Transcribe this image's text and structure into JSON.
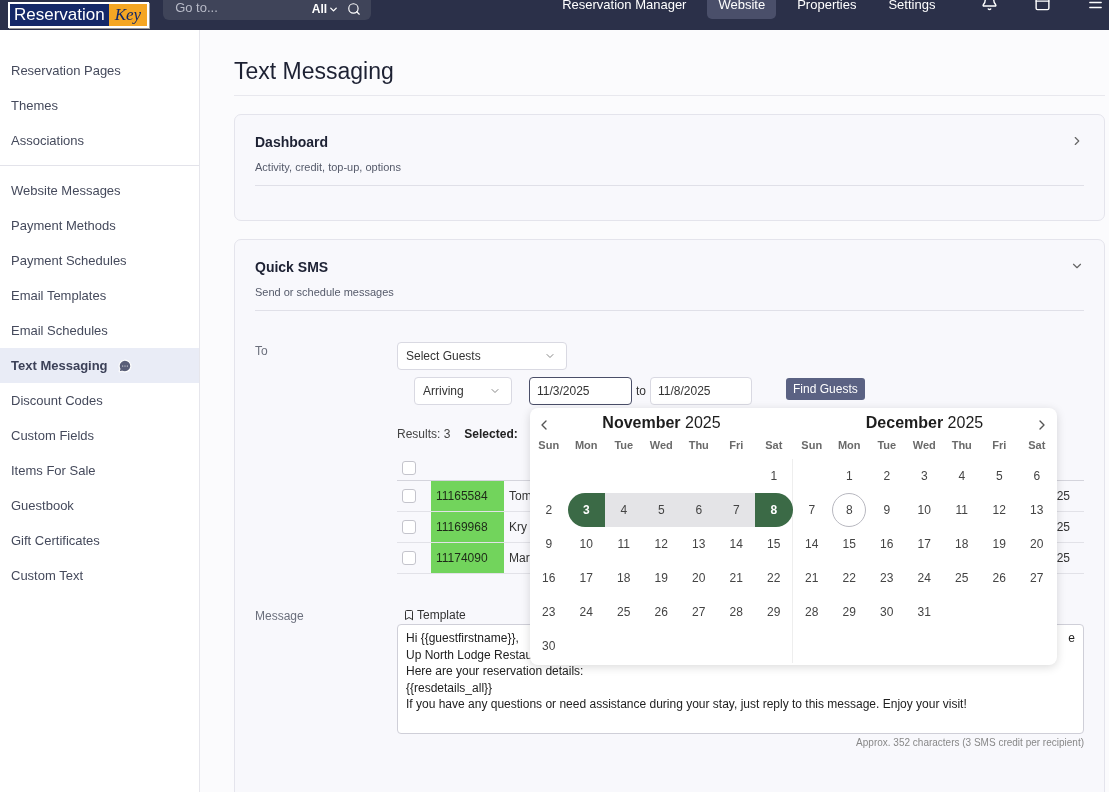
{
  "header": {
    "logo": {
      "word": "Reservation",
      "accent": "Key"
    },
    "search": {
      "placeholder": "Go to...",
      "scope": "All"
    },
    "nav": [
      {
        "label": "Reservation Manager",
        "selected": false
      },
      {
        "label": "Website",
        "selected": true
      },
      {
        "label": "Properties",
        "selected": false
      },
      {
        "label": "Settings",
        "selected": false
      }
    ]
  },
  "sidebar": {
    "groups": [
      [
        {
          "label": "Reservation Pages",
          "selected": false,
          "chat_icon": false
        },
        {
          "label": "Themes",
          "selected": false,
          "chat_icon": false
        },
        {
          "label": "Associations",
          "selected": false,
          "chat_icon": false
        }
      ],
      [
        {
          "label": "Website Messages",
          "selected": false,
          "chat_icon": false
        },
        {
          "label": "Payment Methods",
          "selected": false,
          "chat_icon": false
        },
        {
          "label": "Payment Schedules",
          "selected": false,
          "chat_icon": false
        },
        {
          "label": "Email Templates",
          "selected": false,
          "chat_icon": false
        },
        {
          "label": "Email Schedules",
          "selected": false,
          "chat_icon": false
        },
        {
          "label": "Text Messaging",
          "selected": true,
          "chat_icon": true
        },
        {
          "label": "Discount Codes",
          "selected": false,
          "chat_icon": false
        },
        {
          "label": "Custom Fields",
          "selected": false,
          "chat_icon": false
        },
        {
          "label": "Items For Sale",
          "selected": false,
          "chat_icon": false
        },
        {
          "label": "Guestbook",
          "selected": false,
          "chat_icon": false
        },
        {
          "label": "Gift Certificates",
          "selected": false,
          "chat_icon": false
        },
        {
          "label": "Custom Text",
          "selected": false,
          "chat_icon": false
        }
      ]
    ]
  },
  "page_title": "Text Messaging",
  "sections": [
    {
      "title": "Dashboard",
      "subtitle": "Activity, credit, top-up, options",
      "expanded": false
    },
    {
      "title": "Quick SMS",
      "subtitle": "Send or schedule messages",
      "expanded": true
    }
  ],
  "quick_sms": {
    "to_label": "To",
    "guest_select": "Select Guests",
    "date_filter": "Arriving",
    "date_from": "11/3/2025",
    "between": "to",
    "date_to": "11/8/2025",
    "find_button": "Find Guests",
    "results": "Results: 3",
    "selected_label": "Selected:",
    "table": {
      "header_checked": false,
      "rows": [
        {
          "checked": false,
          "id": "11165584",
          "color": "#72d45c",
          "name": "Tom",
          "column_3": "25"
        },
        {
          "checked": false,
          "id": "11169968",
          "color": "#72d45c",
          "name": "Kry",
          "column_3": "25"
        },
        {
          "checked": false,
          "id": "11174090",
          "color": "#72d45c",
          "name": "Mar",
          "column_3": "25"
        }
      ]
    },
    "message_label": "Message",
    "template_button": "Template",
    "message_lines": [
      "Hi {{guestfirstname}},",
      "Up North Lodge Restau",
      "Here are your reservation details:",
      "{{resdetails_all}}",
      "If you have any questions or need assistance during your stay, just reply to this message. Enjoy your visit!"
    ],
    "line1_tail": "e",
    "char_count": "Approx. 352 characters (3 SMS credit per recipient)"
  },
  "calendar": {
    "months": [
      {
        "month": "November",
        "year": "2025",
        "weekdays": [
          "Sun",
          "Mon",
          "Tue",
          "Wed",
          "Thu",
          "Fri",
          "Sat"
        ],
        "weeks": [
          {
            "kind": "end",
            "days": [
              {
                "d": "1",
                "selected": false,
                "in_range": false,
                "today": false
              }
            ]
          },
          {
            "kind": "full",
            "days": [
              {
                "d": "2",
                "selected": false,
                "in_range": false,
                "today": false
              },
              {
                "d": "3",
                "selected": true,
                "in_range": false,
                "today": false
              },
              {
                "d": "4",
                "selected": false,
                "in_range": true,
                "today": false
              },
              {
                "d": "5",
                "selected": false,
                "in_range": true,
                "today": false
              },
              {
                "d": "6",
                "selected": false,
                "in_range": true,
                "today": false
              },
              {
                "d": "7",
                "selected": false,
                "in_range": true,
                "today": false
              },
              {
                "d": "8",
                "selected": true,
                "in_range": false,
                "today": false
              }
            ]
          },
          {
            "kind": "full",
            "days": [
              {
                "d": "9",
                "selected": false,
                "in_range": false,
                "today": false
              },
              {
                "d": "10",
                "selected": false,
                "in_range": false,
                "today": false
              },
              {
                "d": "11",
                "selected": false,
                "in_range": false,
                "today": false
              },
              {
                "d": "12",
                "selected": false,
                "in_range": false,
                "today": false
              },
              {
                "d": "13",
                "selected": false,
                "in_range": false,
                "today": false
              },
              {
                "d": "14",
                "selected": false,
                "in_range": false,
                "today": false
              },
              {
                "d": "15",
                "selected": false,
                "in_range": false,
                "today": false
              }
            ]
          },
          {
            "kind": "full",
            "days": [
              {
                "d": "16",
                "selected": false,
                "in_range": false,
                "today": false
              },
              {
                "d": "17",
                "selected": false,
                "in_range": false,
                "today": false
              },
              {
                "d": "18",
                "selected": false,
                "in_range": false,
                "today": false
              },
              {
                "d": "19",
                "selected": false,
                "in_range": false,
                "today": false
              },
              {
                "d": "20",
                "selected": false,
                "in_range": false,
                "today": false
              },
              {
                "d": "21",
                "selected": false,
                "in_range": false,
                "today": false
              },
              {
                "d": "22",
                "selected": false,
                "in_range": false,
                "today": false
              }
            ]
          },
          {
            "kind": "full",
            "days": [
              {
                "d": "23",
                "selected": false,
                "in_range": false,
                "today": false
              },
              {
                "d": "24",
                "selected": false,
                "in_range": false,
                "today": false
              },
              {
                "d": "25",
                "selected": false,
                "in_range": false,
                "today": false
              },
              {
                "d": "26",
                "selected": false,
                "in_range": false,
                "today": false
              },
              {
                "d": "27",
                "selected": false,
                "in_range": false,
                "today": false
              },
              {
                "d": "28",
                "selected": false,
                "in_range": false,
                "today": false
              },
              {
                "d": "29",
                "selected": false,
                "in_range": false,
                "today": false
              }
            ]
          },
          {
            "kind": "start",
            "days": [
              {
                "d": "30",
                "selected": false,
                "in_range": false,
                "today": false
              }
            ]
          }
        ]
      },
      {
        "month": "December",
        "year": "2025",
        "weekdays": [
          "Sun",
          "Mon",
          "Tue",
          "Wed",
          "Thu",
          "Fri",
          "Sat"
        ],
        "weeks": [
          {
            "kind": "end",
            "days": [
              {
                "d": "1",
                "selected": false,
                "in_range": false,
                "today": false
              },
              {
                "d": "2",
                "selected": false,
                "in_range": false,
                "today": false
              },
              {
                "d": "3",
                "selected": false,
                "in_range": false,
                "today": false
              },
              {
                "d": "4",
                "selected": false,
                "in_range": false,
                "today": false
              },
              {
                "d": "5",
                "selected": false,
                "in_range": false,
                "today": false
              },
              {
                "d": "6",
                "selected": false,
                "in_range": false,
                "today": false
              }
            ]
          },
          {
            "kind": "full",
            "days": [
              {
                "d": "7",
                "selected": false,
                "in_range": false,
                "today": false
              },
              {
                "d": "8",
                "selected": false,
                "in_range": false,
                "today": true
              },
              {
                "d": "9",
                "selected": false,
                "in_range": false,
                "today": false
              },
              {
                "d": "10",
                "selected": false,
                "in_range": false,
                "today": false
              },
              {
                "d": "11",
                "selected": false,
                "in_range": false,
                "today": false
              },
              {
                "d": "12",
                "selected": false,
                "in_range": false,
                "today": false
              },
              {
                "d": "13",
                "selected": false,
                "in_range": false,
                "today": false
              }
            ]
          },
          {
            "kind": "full",
            "days": [
              {
                "d": "14",
                "selected": false,
                "in_range": false,
                "today": false
              },
              {
                "d": "15",
                "selected": false,
                "in_range": false,
                "today": false
              },
              {
                "d": "16",
                "selected": false,
                "in_range": false,
                "today": false
              },
              {
                "d": "17",
                "selected": false,
                "in_range": false,
                "today": false
              },
              {
                "d": "18",
                "selected": false,
                "in_range": false,
                "today": false
              },
              {
                "d": "19",
                "selected": false,
                "in_range": false,
                "today": false
              },
              {
                "d": "20",
                "selected": false,
                "in_range": false,
                "today": false
              }
            ]
          },
          {
            "kind": "full",
            "days": [
              {
                "d": "21",
                "selected": false,
                "in_range": false,
                "today": false
              },
              {
                "d": "22",
                "selected": false,
                "in_range": false,
                "today": false
              },
              {
                "d": "23",
                "selected": false,
                "in_range": false,
                "today": false
              },
              {
                "d": "24",
                "selected": false,
                "in_range": false,
                "today": false
              },
              {
                "d": "25",
                "selected": false,
                "in_range": false,
                "today": false
              },
              {
                "d": "26",
                "selected": false,
                "in_range": false,
                "today": false
              },
              {
                "d": "27",
                "selected": false,
                "in_range": false,
                "today": false
              }
            ]
          },
          {
            "kind": "start",
            "days": [
              {
                "d": "28",
                "selected": false,
                "in_range": false,
                "today": false
              },
              {
                "d": "29",
                "selected": false,
                "in_range": false,
                "today": false
              },
              {
                "d": "30",
                "selected": false,
                "in_range": false,
                "today": false
              },
              {
                "d": "31",
                "selected": false,
                "in_range": false,
                "today": false
              }
            ]
          }
        ]
      }
    ]
  }
}
